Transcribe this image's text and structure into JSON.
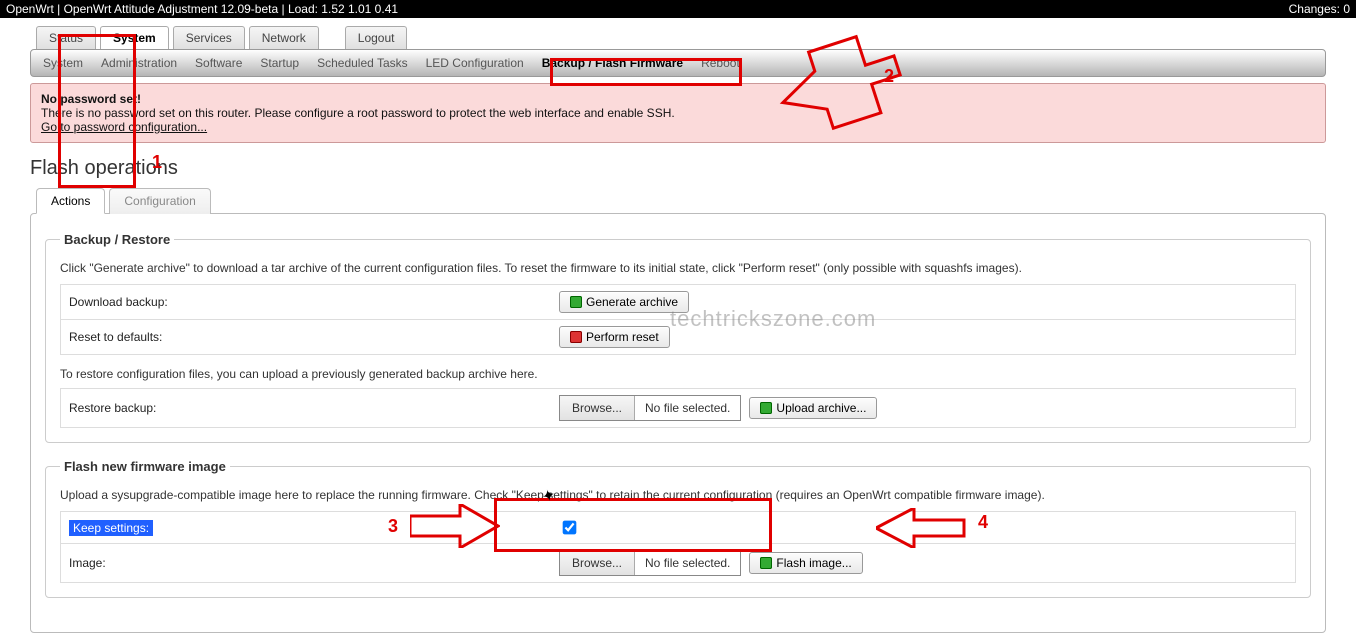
{
  "topbar": {
    "left": "OpenWrt | OpenWrt Attitude Adjustment 12.09-beta | Load: 1.52 1.01 0.41",
    "right": "Changes: 0"
  },
  "maintabs": {
    "items": [
      "Status",
      "System",
      "Services",
      "Network"
    ],
    "active": "System",
    "logout": "Logout"
  },
  "subtabs": {
    "items": [
      "System",
      "Administration",
      "Software",
      "Startup",
      "Scheduled Tasks",
      "LED Configuration",
      "Backup / Flash Firmware",
      "Reboot"
    ],
    "active": "Backup / Flash Firmware"
  },
  "warning": {
    "title": "No password set!",
    "text": "There is no password set on this router. Please configure a root password to protect the web interface and enable SSH.",
    "link": "Go to password configuration..."
  },
  "page_title": "Flash operations",
  "innertabs": {
    "items": [
      "Actions",
      "Configuration"
    ],
    "active": "Actions"
  },
  "backup": {
    "legend": "Backup / Restore",
    "desc": "Click \"Generate archive\" to download a tar archive of the current configuration files. To reset the firmware to its initial state, click \"Perform reset\" (only possible with squashfs images).",
    "download_label": "Download backup:",
    "generate_btn": "Generate archive",
    "reset_label": "Reset to defaults:",
    "perform_reset_btn": "Perform reset",
    "restore_note": "To restore configuration files, you can upload a previously generated backup archive here.",
    "restore_label": "Restore backup:",
    "browse_btn": "Browse...",
    "no_file": "No file selected.",
    "upload_btn": "Upload archive..."
  },
  "flash": {
    "legend": "Flash new firmware image",
    "desc": "Upload a sysupgrade-compatible image here to replace the running firmware. Check \"Keep settings\" to retain the current configuration (requires an OpenWrt compatible firmware image).",
    "keep_label": "Keep settings:",
    "keep_checked": true,
    "image_label": "Image:",
    "browse_btn": "Browse...",
    "no_file": "No file selected.",
    "flash_btn": "Flash image..."
  },
  "annotations": {
    "n1": "1",
    "n2": "2",
    "n3": "3",
    "n4": "4",
    "watermark": "techtrickszone.com"
  }
}
